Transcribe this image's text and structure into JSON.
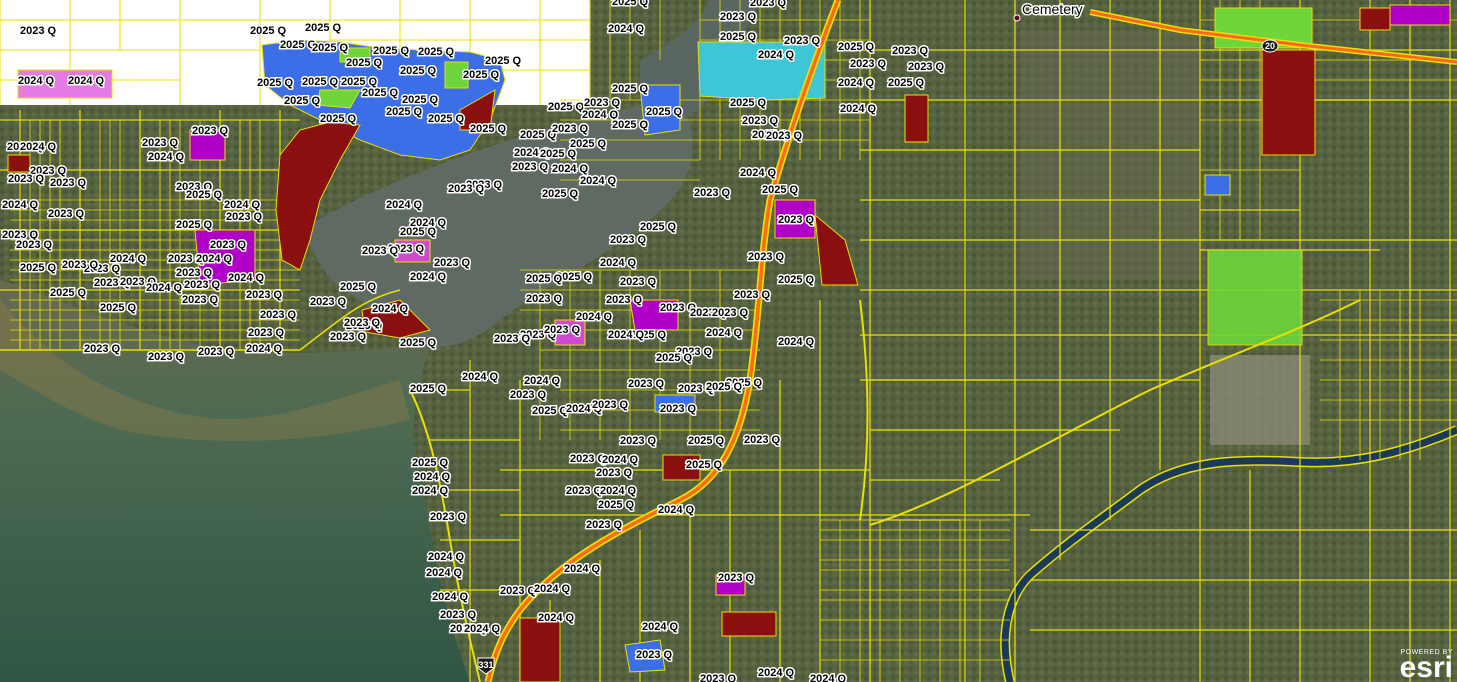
{
  "place_label": "Cemetery",
  "shields": [
    {
      "number": "20",
      "kind": "state-route-shield"
    },
    {
      "number": "331",
      "kind": "us-route-shield"
    }
  ],
  "attribution": {
    "top": "POWERED BY",
    "logo": "esri"
  },
  "legend_colors": {
    "parcel_outline": "#e8e000",
    "highway": "#ff6a1a",
    "class_2023": "#b000c8",
    "class_2024": "#d04ad0",
    "class_2025": "#3c6ee8",
    "class_red": "#8a1010",
    "class_green": "#6ed63a",
    "class_cyan": "#3ec6d8",
    "water": "#3c5a44",
    "river": "#1a3a58"
  },
  "parcel_labels": [
    {
      "text": "2023 Q"
    },
    {
      "text": "2025 Q"
    },
    {
      "text": "2025 Q"
    },
    {
      "text": "2025 Q"
    },
    {
      "text": "2025 Q"
    },
    {
      "text": "2025 Q"
    },
    {
      "text": "2025 Q"
    },
    {
      "text": "2025 Q"
    },
    {
      "text": "2025 Q"
    },
    {
      "text": "2025 Q"
    },
    {
      "text": "2024 Q"
    },
    {
      "text": "2024 Q"
    },
    {
      "text": "2025 Q"
    },
    {
      "text": "2025 Q"
    },
    {
      "text": "2025 Q"
    },
    {
      "text": "2025 Q"
    },
    {
      "text": "2025 Q"
    },
    {
      "text": "2025 Q"
    },
    {
      "text": "2025 Q"
    },
    {
      "text": "2025 Q"
    },
    {
      "text": "2025 Q"
    },
    {
      "text": "2025 Q"
    },
    {
      "text": "2025 Q"
    },
    {
      "text": "2023 Q"
    },
    {
      "text": "2023 Q"
    },
    {
      "text": "2023 Q"
    },
    {
      "text": "2023 Q"
    },
    {
      "text": "2024 Q"
    },
    {
      "text": "2023 Q"
    },
    {
      "text": "2023 Q"
    },
    {
      "text": "2024 Q"
    },
    {
      "text": "2023 Q"
    },
    {
      "text": "2023 Q"
    },
    {
      "text": "2025 Q"
    },
    {
      "text": "2025 Q"
    },
    {
      "text": "2024 Q"
    },
    {
      "text": "2023 Q"
    },
    {
      "text": "2024 Q"
    },
    {
      "text": "2023 Q"
    },
    {
      "text": "2023 Q"
    },
    {
      "text": "2024 Q"
    },
    {
      "text": "2023 Q"
    },
    {
      "text": "2023 Q"
    },
    {
      "text": "2023 Q"
    },
    {
      "text": "2024 Q"
    },
    {
      "text": "2023 Q"
    },
    {
      "text": "2025 Q"
    },
    {
      "text": "2025 Q"
    },
    {
      "text": "2025 Q"
    },
    {
      "text": "2023 Q"
    },
    {
      "text": "2023 Q"
    },
    {
      "text": "2023 Q"
    },
    {
      "text": "2024 Q"
    },
    {
      "text": "2023 Q"
    },
    {
      "text": "2023 Q"
    },
    {
      "text": "2024 Q"
    },
    {
      "text": "2023 Q"
    },
    {
      "text": "2023 Q"
    },
    {
      "text": "2023 Q"
    },
    {
      "text": "2023 Q"
    },
    {
      "text": "2024 Q"
    },
    {
      "text": "2023 Q"
    },
    {
      "text": "2023 Q"
    },
    {
      "text": "2023 Q"
    },
    {
      "text": "2025 Q"
    },
    {
      "text": "2024 Q"
    },
    {
      "text": "2023 Q"
    },
    {
      "text": "2023 Q"
    },
    {
      "text": "2025 Q"
    },
    {
      "text": "2023 Q"
    },
    {
      "text": "2023 Q"
    },
    {
      "text": "2023 Q"
    },
    {
      "text": "2024 Q"
    },
    {
      "text": "2025 Q"
    },
    {
      "text": "2024 Q"
    },
    {
      "text": "2023 Q"
    },
    {
      "text": "2023 Q"
    },
    {
      "text": "2024 Q"
    },
    {
      "text": "2023 Q"
    },
    {
      "text": "2025 Q"
    },
    {
      "text": "2024 Q"
    },
    {
      "text": "2023 Q"
    },
    {
      "text": "2023 Q"
    },
    {
      "text": "2025 Q"
    },
    {
      "text": "2023 Q"
    },
    {
      "text": "2024 Q"
    },
    {
      "text": "2025 Q"
    },
    {
      "text": "2023 Q"
    },
    {
      "text": "2023 Q"
    },
    {
      "text": "2023 Q"
    },
    {
      "text": "2024 Q"
    },
    {
      "text": "2025 Q"
    },
    {
      "text": "2024 Q"
    },
    {
      "text": "2025 Q"
    },
    {
      "text": "2023 Q"
    },
    {
      "text": "2025 Q"
    },
    {
      "text": "2023 Q"
    },
    {
      "text": "2023 Q"
    },
    {
      "text": "2025 Q"
    },
    {
      "text": "2024 Q"
    },
    {
      "text": "2023 Q"
    },
    {
      "text": "2025 Q"
    },
    {
      "text": "2023 Q"
    },
    {
      "text": "2025 Q"
    },
    {
      "text": "2024 Q"
    },
    {
      "text": "2025 Q"
    },
    {
      "text": "2025 Q"
    },
    {
      "text": "2025 Q"
    },
    {
      "text": "2023 Q"
    },
    {
      "text": "2025 Q"
    },
    {
      "text": "2024 Q"
    },
    {
      "text": "2025 Q"
    },
    {
      "text": "2023 Q"
    },
    {
      "text": "2024 Q"
    },
    {
      "text": "2024 Q"
    },
    {
      "text": "2025 Q"
    },
    {
      "text": "2025 Q"
    },
    {
      "text": "2023 Q"
    },
    {
      "text": "2024 Q"
    },
    {
      "text": "2023 Q"
    },
    {
      "text": "2025 Q"
    },
    {
      "text": "2025 Q"
    },
    {
      "text": "2023 Q"
    },
    {
      "text": "2023 Q"
    },
    {
      "text": "2023 Q"
    },
    {
      "text": "2024 Q"
    },
    {
      "text": "2023 Q"
    },
    {
      "text": "2025 Q"
    },
    {
      "text": "2023 Q"
    },
    {
      "text": "2023 Q"
    },
    {
      "text": "2023 Q"
    },
    {
      "text": "2024 Q"
    },
    {
      "text": "2023 Q"
    },
    {
      "text": "2025 Q"
    },
    {
      "text": "2024 Q"
    },
    {
      "text": "2023 Q"
    },
    {
      "text": "2025 Q"
    },
    {
      "text": "2024 Q"
    },
    {
      "text": "2023 Q"
    },
    {
      "text": "2024 Q"
    },
    {
      "text": "2025 Q"
    },
    {
      "text": "2024 Q"
    },
    {
      "text": "2023 Q"
    },
    {
      "text": "2023 Q"
    },
    {
      "text": "2023 Q"
    },
    {
      "text": "2023 Q"
    },
    {
      "text": "2025 Q"
    },
    {
      "text": "2025 Q"
    },
    {
      "text": "2023 Q"
    },
    {
      "text": "2023 Q"
    },
    {
      "text": "2024 Q"
    },
    {
      "text": "2023 Q"
    },
    {
      "text": "2023 Q"
    },
    {
      "text": "2024 Q"
    },
    {
      "text": "2025 Q"
    },
    {
      "text": "2023 Q"
    },
    {
      "text": "2024 Q"
    },
    {
      "text": "2025 Q"
    },
    {
      "text": "2023 Q"
    },
    {
      "text": "2025 Q"
    },
    {
      "text": "2025 Q"
    },
    {
      "text": "2024 Q"
    },
    {
      "text": "2024 Q"
    },
    {
      "text": "2023 Q"
    },
    {
      "text": "2024 Q"
    },
    {
      "text": "2024 Q"
    },
    {
      "text": "2024 Q"
    },
    {
      "text": "2023 Q"
    },
    {
      "text": "2023 Q"
    },
    {
      "text": "2024 Q"
    },
    {
      "text": "2023 Q"
    },
    {
      "text": "2024 Q"
    },
    {
      "text": "2024 Q"
    },
    {
      "text": "2024 Q"
    },
    {
      "text": "2023 Q"
    },
    {
      "text": "2024 Q"
    },
    {
      "text": "2023 Q"
    },
    {
      "text": "2023 Q"
    },
    {
      "text": "2024 Q"
    },
    {
      "text": "2024 Q"
    },
    {
      "text": "2023 Q"
    },
    {
      "text": "2025 Q"
    },
    {
      "text": "2023 Q"
    },
    {
      "text": "2024 Q"
    }
  ]
}
